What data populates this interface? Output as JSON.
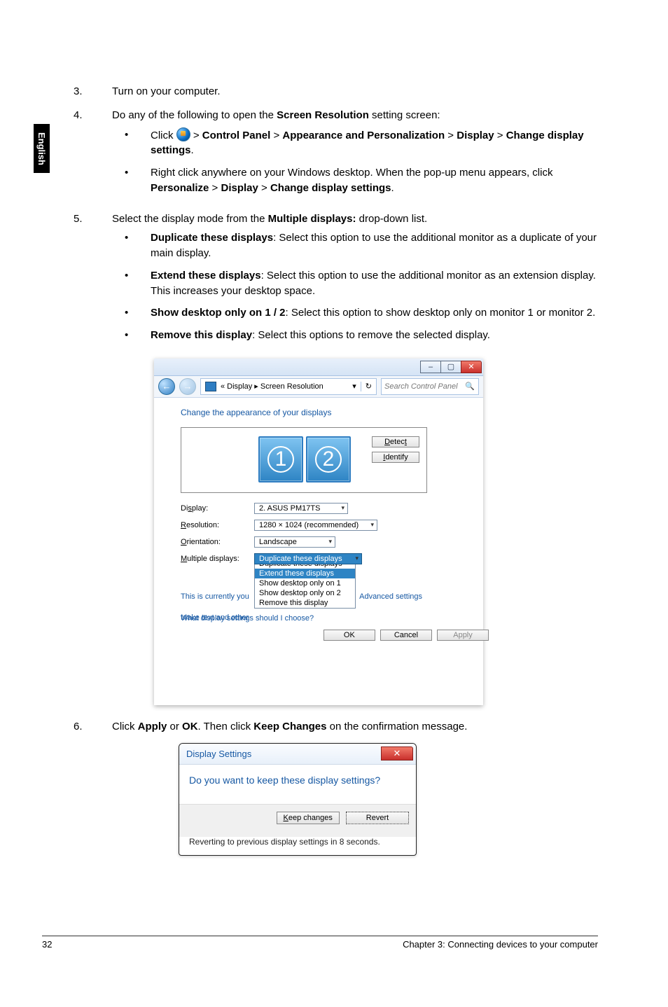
{
  "sideTab": "English",
  "steps": {
    "s3": {
      "num": "3.",
      "text": "Turn on your computer."
    },
    "s4": {
      "num": "4.",
      "text_a": "Do any of the following to open the ",
      "bold_a": "Screen Resolution",
      "text_b": " setting screen:",
      "a": {
        "pre": "Click ",
        "p1": "Control Panel",
        "p2": "Appearance and Personalization",
        "p3": "Display",
        "p4": "Change display settings",
        "sep": " > "
      },
      "b": {
        "pre": "Right click anywhere on your Windows desktop. When the pop-up menu appears, click ",
        "p1": "Personalize",
        "p2": "Display",
        "p3": "Change display settings",
        "sep": " > "
      }
    },
    "s5": {
      "num": "5.",
      "text_a": "Select the display mode from the ",
      "bold_a": "Multiple displays:",
      "text_b": " drop-down list.",
      "opt1": {
        "title": "Duplicate these displays",
        "desc": ": Select this option to use the additional monitor as a duplicate of your main display."
      },
      "opt2": {
        "title": "Extend these displays",
        "desc": ": Select this option to use the additional monitor as an extension display. This increases your desktop space."
      },
      "opt3": {
        "title": "Show desktop only on 1 / 2",
        "desc": ": Select this option to show desktop only on monitor 1 or monitor 2."
      },
      "opt4": {
        "title": "Remove this display",
        "desc": ": Select this options to remove the selected display."
      }
    },
    "s6": {
      "num": "6.",
      "a": "Click ",
      "b1": "Apply",
      "or": " or ",
      "b2": "OK",
      "c": ". Then click ",
      "b3": "Keep Changes",
      "d": " on the confirmation message."
    }
  },
  "win1": {
    "breadcrumb_a": "«  Display  ▸  Screen Resolution",
    "search_placeholder": "Search Control Panel",
    "heading": "Change the appearance of your displays",
    "detect": "Detect",
    "identify": "Identify",
    "mon1": "1",
    "mon2": "2",
    "display_lbl": "Display:",
    "display_val": "2. ASUS PM17TS",
    "res_lbl": "Resolution:",
    "res_val": "1280 × 1024 (recommended)",
    "orient_lbl": "Orientation:",
    "orient_val": "Landscape",
    "mult_lbl": "Multiple displays:",
    "mult_val": "Duplicate these displays",
    "dd0": "Duplicate these displays",
    "dd1": "Extend these displays",
    "dd2": "Show desktop only on 1",
    "dd3": "Show desktop only on 2",
    "dd4": "Remove this display",
    "curmain_a": "This is currently you",
    "textsize_a": "Make text and other",
    "whatsettings": "What display settings should I choose?",
    "advanced": "Advanced settings",
    "ok": "OK",
    "cancel": "Cancel",
    "apply": "Apply"
  },
  "win2": {
    "title": "Display Settings",
    "question": "Do you want to keep these display settings?",
    "keep": "Keep changes",
    "revert": "Revert",
    "foot": "Reverting to previous display settings in 8 seconds."
  },
  "footer": {
    "page": "32",
    "chapter": "Chapter 3: Connecting devices to your computer"
  }
}
